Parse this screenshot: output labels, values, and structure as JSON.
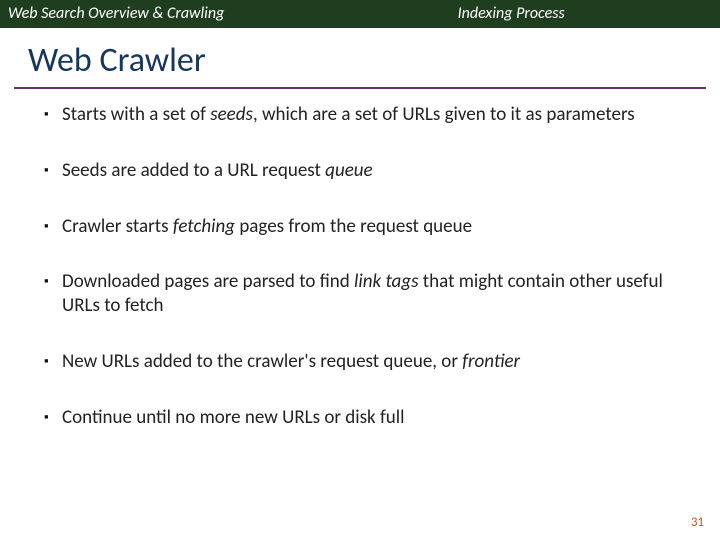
{
  "header": {
    "left": "Web Search Overview & Crawling",
    "right": "Indexing Process"
  },
  "title": "Web Crawler",
  "bullets": [
    {
      "pre": "Starts with a set of ",
      "kw": "seeds",
      "post": ", which are a set of URLs given to it as parameters"
    },
    {
      "pre": "Seeds are added to a URL request ",
      "kw": "queue",
      "post": ""
    },
    {
      "pre": "Crawler starts ",
      "kw": "fetching",
      "post": " pages from the request queue"
    },
    {
      "pre": "Downloaded pages are parsed to find ",
      "kw": "link tags",
      "post": " that might contain other useful URLs to fetch"
    },
    {
      "pre": "New URLs added to the crawler's request queue, or ",
      "kw": "frontier",
      "post": ""
    },
    {
      "pre": "Continue until no more new URLs or disk full",
      "kw": "",
      "post": ""
    }
  ],
  "pagenum": "31"
}
